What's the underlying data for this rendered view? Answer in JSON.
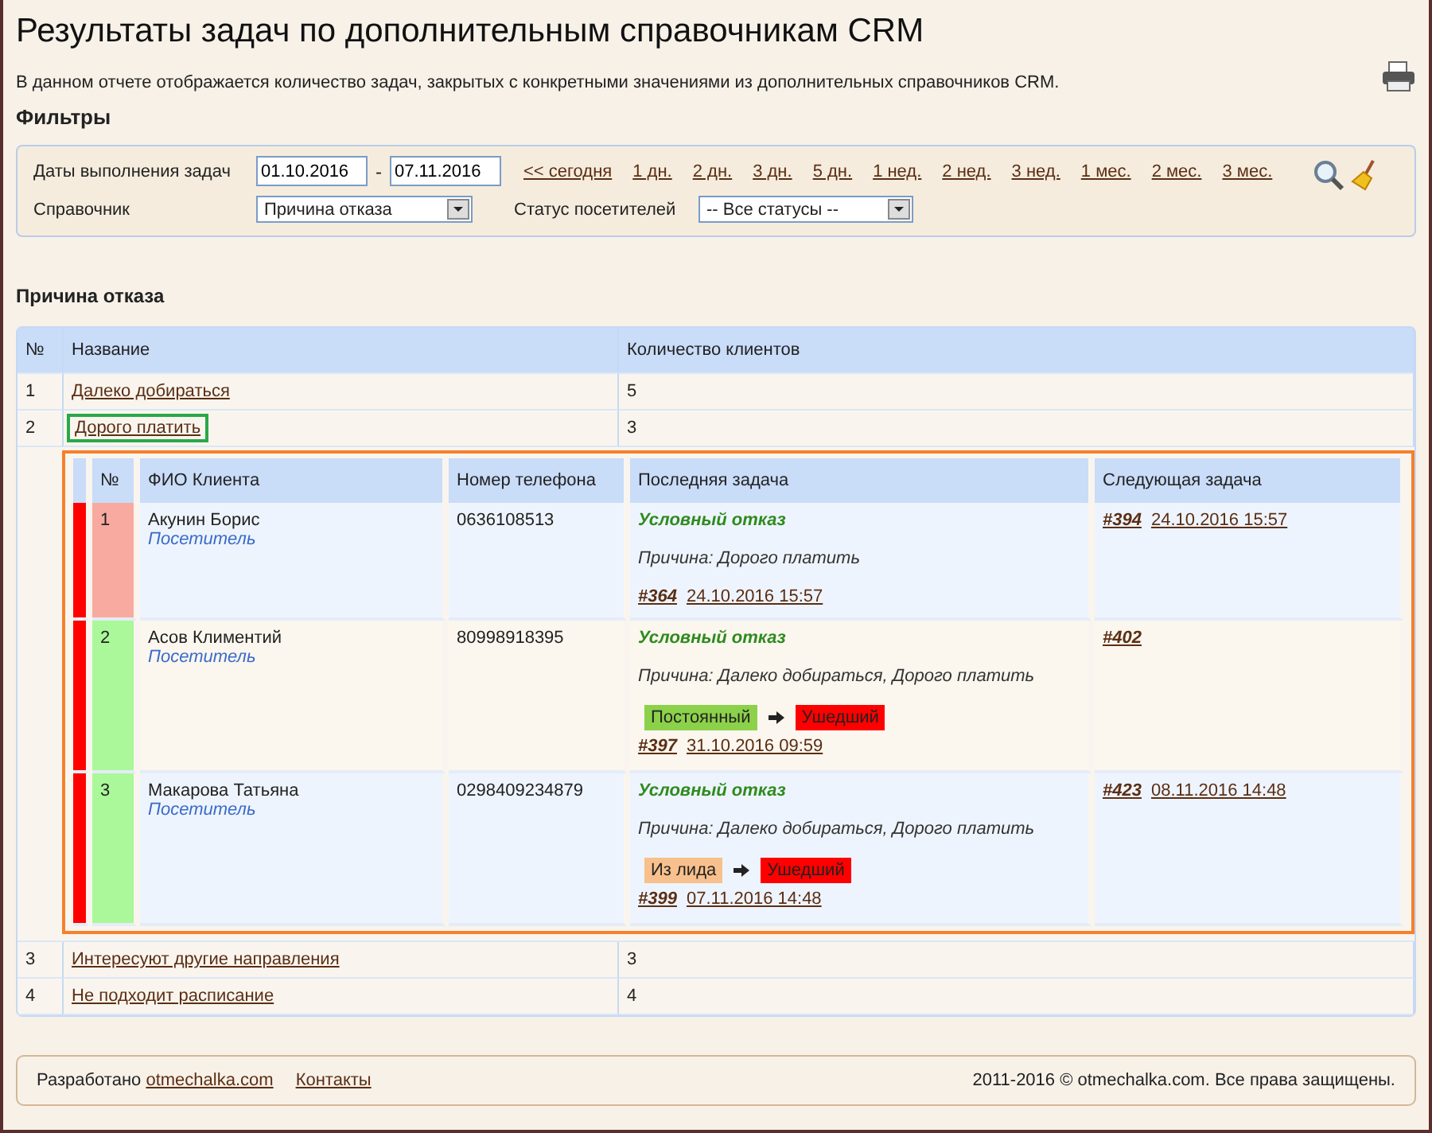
{
  "title": "Результаты задач по дополнительным справочникам CRM",
  "description": "В данном отчете отображается количество задач, закрытых с конкретными значениями из дополнительных справочников CRM.",
  "filters": {
    "heading": "Фильтры",
    "date_label": "Даты выполнения задач",
    "date_from": "01.10.2016",
    "date_separator": "-",
    "date_to": "07.11.2016",
    "quick_ranges": [
      "<<  сегодня",
      "1 дн.",
      "2 дн.",
      "3 дн.",
      "5 дн.",
      "1 нед.",
      "2 нед.",
      "3 нед.",
      "1 мес.",
      "2 мес.",
      "3 мес."
    ],
    "directory_label": "Справочник",
    "directory_value": "Причина отказа",
    "status_label": "Статус посетителей",
    "status_value": "-- Все статусы --"
  },
  "section_title": "Причина отказа",
  "table": {
    "columns": [
      "№",
      "Название",
      "Количество клиентов"
    ],
    "rows": [
      {
        "num": "1",
        "name": "Далеко добираться",
        "count": "5",
        "focused": false
      },
      {
        "num": "2",
        "name": "Дорого платить",
        "count": "3",
        "focused": true,
        "details": {
          "columns": [
            "№",
            "ФИО Клиента",
            "Номер телефона",
            "Последняя задача",
            "Следующая задача"
          ],
          "clients": [
            {
              "num": "1",
              "color": "#f8aaa0",
              "name": "Акунин Борис",
              "type": "Посетитель",
              "phone": "0636108513",
              "result": "Условный отказ",
              "reason": "Причина: Дорого платить",
              "task_id": "#364",
              "task_date": "24.10.2016 15:57",
              "next_id": "#394",
              "next_date": "24.10.2016 15:57"
            },
            {
              "num": "2",
              "color": "#aaf89a",
              "name": "Асов Климентий",
              "type": "Посетитель",
              "phone": "80998918395",
              "result": "Условный отказ",
              "reason": "Причина: Далеко добираться, Дорого платить",
              "transition": [
                {
                  "label": "Постоянный",
                  "color": "#8cd14a"
                },
                {
                  "label": "Ушедший",
                  "color": "#ff0000"
                }
              ],
              "task_id": "#397",
              "task_date": "31.10.2016 09:59",
              "next_id": "#402"
            },
            {
              "num": "3",
              "color": "#aaf89a",
              "name": "Макарова Татьяна",
              "type": "Посетитель",
              "phone": "0298409234879",
              "result": "Условный отказ",
              "reason": "Причина: Далеко добираться, Дорого платить",
              "transition": [
                {
                  "label": "Из лида",
                  "color": "#f8c08c"
                },
                {
                  "label": "Ушедший",
                  "color": "#ff0000"
                }
              ],
              "task_id": "#399",
              "task_date": "07.11.2016 14:48",
              "next_id": "#423",
              "next_date": "08.11.2016 14:48"
            }
          ]
        }
      },
      {
        "num": "3",
        "name": "Интересуют другие направления",
        "count": "3",
        "focused": false
      },
      {
        "num": "4",
        "name": "Не подходит расписание",
        "count": "4",
        "focused": false
      }
    ]
  },
  "footer": {
    "made_by": "Разработано",
    "site_link": "otmechalka.com",
    "contacts_link": "Контакты",
    "copyright": "2011-2016 © otmechalka.com. Все права защищены."
  }
}
